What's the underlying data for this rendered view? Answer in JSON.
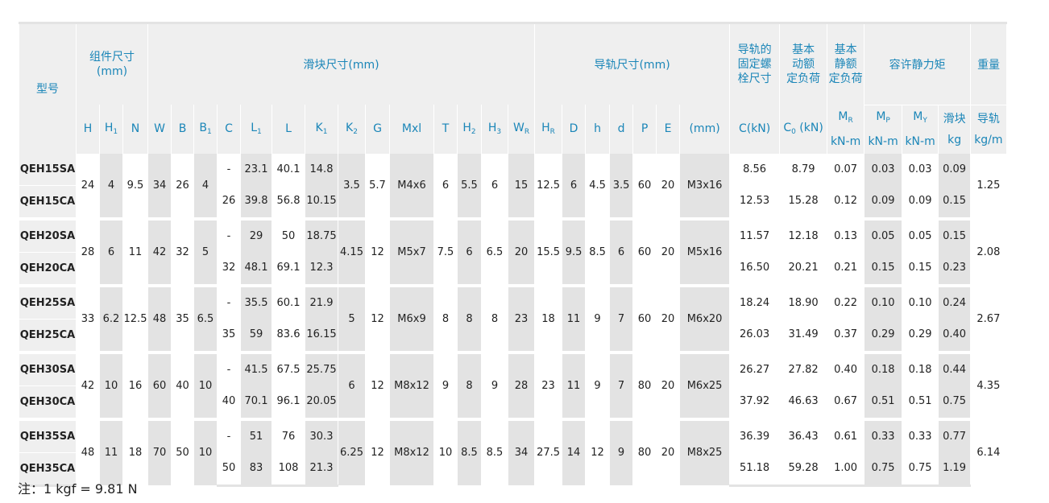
{
  "headers": {
    "model": "型号",
    "assembly": "组件尺寸\n(mm)",
    "block": "滑块尺寸(mm)",
    "rail": "导轨尺寸(mm)",
    "bolt": "导轨的\n固定螺\n栓尺寸",
    "dynamic": "基本\n动额\n定负荷",
    "static": "基本\n静额\n定负荷",
    "moment": "容许静力矩",
    "weight": "重量",
    "cols": {
      "H": "H",
      "H1": "H",
      "N": "N",
      "W": "W",
      "B": "B",
      "B1": "B",
      "C": "C",
      "L1": "L",
      "L": "L",
      "K1": "K",
      "K2": "K",
      "G": "G",
      "Mxl": "Mxl",
      "T": "T",
      "H2": "H",
      "H3": "H",
      "WR": "W",
      "HR": "H",
      "D": "D",
      "h": "h",
      "d": "d",
      "P": "P",
      "E": "E",
      "bolt_unit": "(mm)",
      "C_unit": "C(kN)",
      "C0": "C",
      "C0_unit": " (kN)",
      "MR": "M",
      "MP": "M",
      "MY": "M",
      "block_w": "滑块",
      "rail_w": "导轨",
      "knm": "kN-m",
      "kg": "kg",
      "kgm": "kg/m",
      "sub1": "1",
      "sub2": "2",
      "sub3": "3",
      "subR": "R",
      "subP": "P",
      "subY": "Y",
      "sub0": "0"
    }
  },
  "groups": [
    {
      "H": "24",
      "H1": "4",
      "N": "9.5",
      "W": "34",
      "B": "26",
      "B1": "4",
      "K2": "3.5",
      "G": "5.7",
      "Mxl": "M4x6",
      "T": "6",
      "H2": "5.5",
      "H3": "6",
      "WR": "15",
      "HR": "12.5",
      "D": "6",
      "h": "4.5",
      "d": "3.5",
      "P": "60",
      "E": "20",
      "bolt": "M3x16",
      "rail_w": "1.25",
      "rows": [
        {
          "model": "QEH15SA",
          "C": "-",
          "L1": "23.1",
          "L": "40.1",
          "K1": "14.8",
          "Cd": "8.56",
          "C0": "8.79",
          "MR": "0.07",
          "MP": "0.03",
          "MY": "0.03",
          "bw": "0.09"
        },
        {
          "model": "QEH15CA",
          "C": "26",
          "L1": "39.8",
          "L": "56.8",
          "K1": "10.15",
          "Cd": "12.53",
          "C0": "15.28",
          "MR": "0.12",
          "MP": "0.09",
          "MY": "0.09",
          "bw": "0.15"
        }
      ]
    },
    {
      "H": "28",
      "H1": "6",
      "N": "11",
      "W": "42",
      "B": "32",
      "B1": "5",
      "K2": "4.15",
      "G": "12",
      "Mxl": "M5x7",
      "T": "7.5",
      "H2": "6",
      "H3": "6.5",
      "WR": "20",
      "HR": "15.5",
      "D": "9.5",
      "h": "8.5",
      "d": "6",
      "P": "60",
      "E": "20",
      "bolt": "M5x16",
      "rail_w": "2.08",
      "rows": [
        {
          "model": "QEH20SA",
          "C": "-",
          "L1": "29",
          "L": "50",
          "K1": "18.75",
          "Cd": "11.57",
          "C0": "12.18",
          "MR": "0.13",
          "MP": "0.05",
          "MY": "0.05",
          "bw": "0.15"
        },
        {
          "model": "QEH20CA",
          "C": "32",
          "L1": "48.1",
          "L": "69.1",
          "K1": "12.3",
          "Cd": "16.50",
          "C0": "20.21",
          "MR": "0.21",
          "MP": "0.15",
          "MY": "0.15",
          "bw": "0.23"
        }
      ]
    },
    {
      "H": "33",
      "H1": "6.2",
      "N": "12.5",
      "W": "48",
      "B": "35",
      "B1": "6.5",
      "K2": "5",
      "G": "12",
      "Mxl": "M6x9",
      "T": "8",
      "H2": "8",
      "H3": "8",
      "WR": "23",
      "HR": "18",
      "D": "11",
      "h": "9",
      "d": "7",
      "P": "60",
      "E": "20",
      "bolt": "M6x20",
      "rail_w": "2.67",
      "rows": [
        {
          "model": "QEH25SA",
          "C": "-",
          "L1": "35.5",
          "L": "60.1",
          "K1": "21.9",
          "Cd": "18.24",
          "C0": "18.90",
          "MR": "0.22",
          "MP": "0.10",
          "MY": "0.10",
          "bw": "0.24"
        },
        {
          "model": "QEH25CA",
          "C": "35",
          "L1": "59",
          "L": "83.6",
          "K1": "16.15",
          "Cd": "26.03",
          "C0": "31.49",
          "MR": "0.37",
          "MP": "0.29",
          "MY": "0.29",
          "bw": "0.40"
        }
      ]
    },
    {
      "H": "42",
      "H1": "10",
      "N": "16",
      "W": "60",
      "B": "40",
      "B1": "10",
      "K2": "6",
      "G": "12",
      "Mxl": "M8x12",
      "T": "9",
      "H2": "8",
      "H3": "9",
      "WR": "28",
      "HR": "23",
      "D": "11",
      "h": "9",
      "d": "7",
      "P": "80",
      "E": "20",
      "bolt": "M6x25",
      "rail_w": "4.35",
      "rows": [
        {
          "model": "QEH30SA",
          "C": "-",
          "L1": "41.5",
          "L": "67.5",
          "K1": "25.75",
          "Cd": "26.27",
          "C0": "27.82",
          "MR": "0.40",
          "MP": "0.18",
          "MY": "0.18",
          "bw": "0.44"
        },
        {
          "model": "QEH30CA",
          "C": "40",
          "L1": "70.1",
          "L": "96.1",
          "K1": "20.05",
          "Cd": "37.92",
          "C0": "46.63",
          "MR": "0.67",
          "MP": "0.51",
          "MY": "0.51",
          "bw": "0.75"
        }
      ]
    },
    {
      "H": "48",
      "H1": "11",
      "N": "18",
      "W": "70",
      "B": "50",
      "B1": "10",
      "K2": "6.25",
      "G": "12",
      "Mxl": "M8x12",
      "T": "10",
      "H2": "8.5",
      "H3": "8.5",
      "WR": "34",
      "HR": "27.5",
      "D": "14",
      "h": "12",
      "d": "9",
      "P": "80",
      "E": "20",
      "bolt": "M8x25",
      "rail_w": "6.14",
      "rows": [
        {
          "model": "QEH35SA",
          "C": "-",
          "L1": "51",
          "L": "76",
          "K1": "30.3",
          "Cd": "36.39",
          "C0": "36.43",
          "MR": "0.61",
          "MP": "0.33",
          "MY": "0.33",
          "bw": "0.77"
        },
        {
          "model": "QEH35CA",
          "C": "50",
          "L1": "83",
          "L": "108",
          "K1": "21.3",
          "Cd": "51.18",
          "C0": "59.28",
          "MR": "1.00",
          "MP": "0.75",
          "MY": "0.75",
          "bw": "1.19"
        }
      ]
    }
  ],
  "footnote": "注：1 kgf = 9.81 N",
  "colors": {
    "header_text": "#1b86b8",
    "shade_light": "#efefef",
    "shade_dark": "#e3e3e3"
  }
}
